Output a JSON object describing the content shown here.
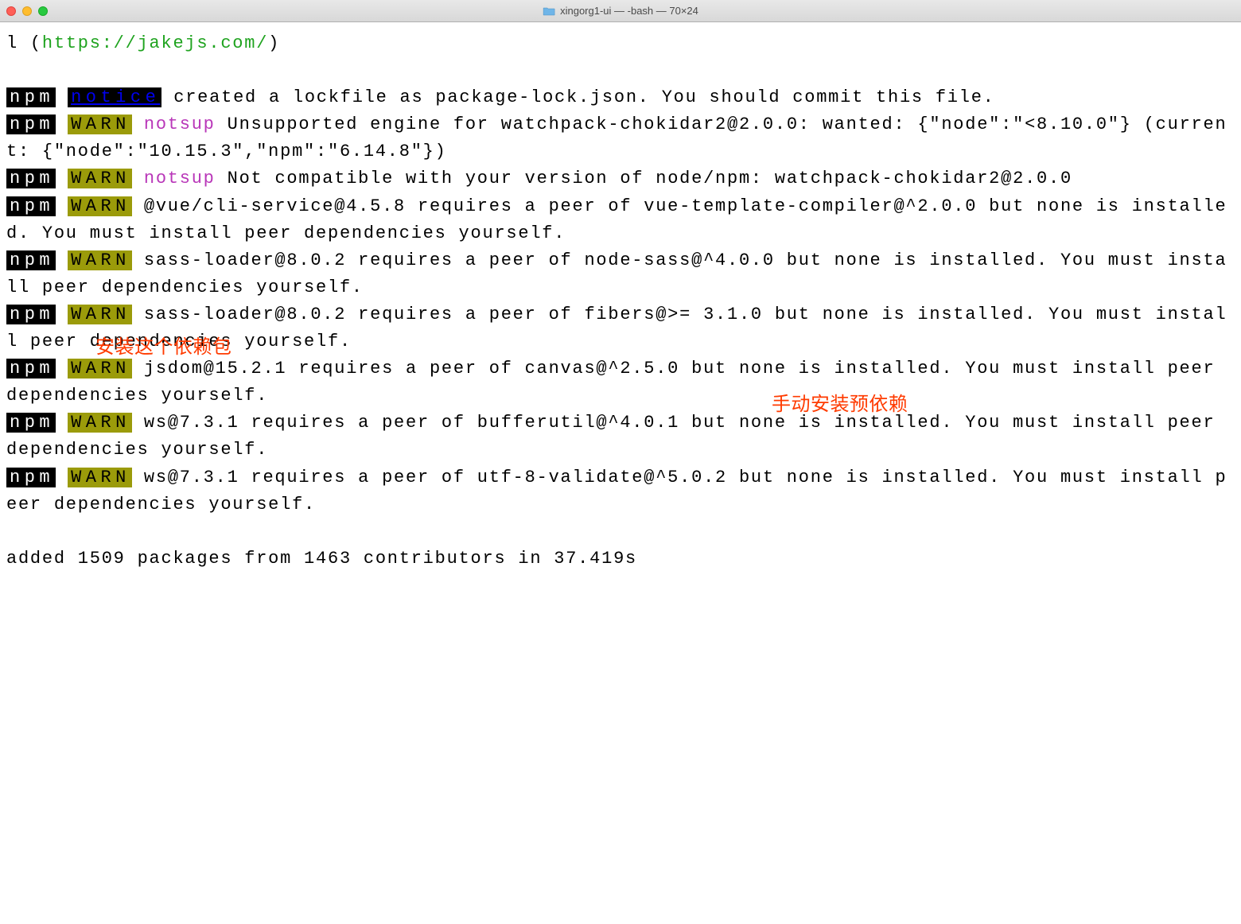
{
  "window": {
    "title": "xingorg1-ui — -bash — 70×24"
  },
  "terminal": {
    "url_prefix": "l (",
    "url": "https://jakejs.com/",
    "url_suffix": ")",
    "npm_label": "npm",
    "notice_label": "notice",
    "warn_label": "WARN",
    "notsup_label": "notsup",
    "notice_text": " created a lockfile as package-lock.json. You should commit this file.",
    "warn1_text": " Unsupported engine for watchpack-chokidar2@2.0.0: wanted: {\"node\":\"<8.10.0\"} (current: {\"node\":\"10.15.3\",\"npm\":\"6.14.8\"})",
    "warn2_text": " Not compatible with your version of node/npm: watchpack-chokidar2@2.0.0",
    "warn3_text": " @vue/cli-service@4.5.8 requires a peer of vue-template-compiler@^2.0.0 but none is installed. You must install peer dependencies yourself.",
    "warn4_text": " sass-loader@8.0.2 requires a peer of node-sass@^4.0.0 but none is installed. You must install peer dependencies yourself.",
    "warn5_text": " sass-loader@8.0.2 requires a peer of fibers@>= 3.1.0 but none is installed. You must install peer dependencies yourself.",
    "warn6_text": " jsdom@15.2.1 requires a peer of canvas@^2.5.0 but none is installed. You must install peer dependencies yourself.",
    "warn7_text": " ws@7.3.1 requires a peer of bufferutil@^4.0.1 but none is installed. You must install peer dependencies yourself.",
    "warn8_text": " ws@7.3.1 requires a peer of utf-8-validate@^5.0.2 but none is installed. You must install peer dependencies yourself.",
    "summary": "added 1509 packages from 1463 contributors in 37.419s"
  },
  "annotations": {
    "a1": "安装这个依赖包",
    "a2": "手动安装预依赖"
  }
}
